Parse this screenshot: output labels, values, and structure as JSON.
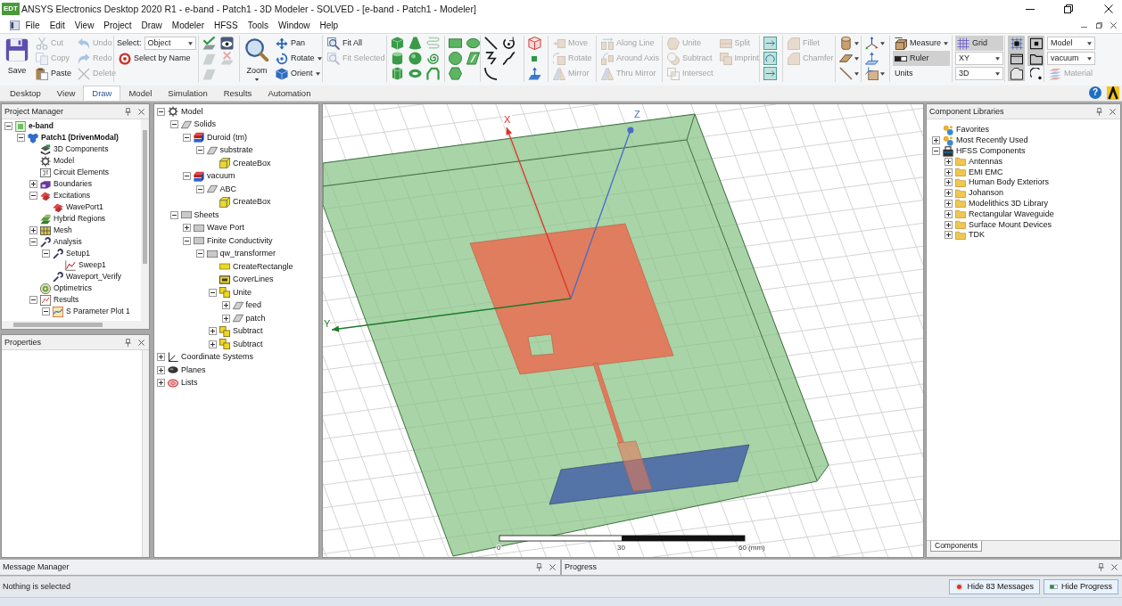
{
  "window": {
    "logo_text": "EDT",
    "title": "ANSYS Electronics Desktop 2020 R1 - e-band - Patch1 - 3D Modeler - SOLVED - [e-band - Patch1 - Modeler]"
  },
  "menu": [
    "File",
    "Edit",
    "View",
    "Project",
    "Draw",
    "Modeler",
    "HFSS",
    "Tools",
    "Window",
    "Help"
  ],
  "ribbon": {
    "groups": [
      {
        "columns": [
          [
            {
              "kind": "large",
              "label": "Save",
              "disabled": false
            }
          ],
          [
            {
              "kind": "button",
              "label": "Cut",
              "disabled": true
            },
            {
              "kind": "button",
              "label": "Copy",
              "disabled": true
            },
            {
              "kind": "button",
              "label": "Paste",
              "disabled": false
            }
          ],
          [
            {
              "kind": "button",
              "label": "Undo",
              "disabled": true
            },
            {
              "kind": "button",
              "label": "Redo",
              "disabled": true
            },
            {
              "kind": "button",
              "label": "Delete",
              "disabled": true
            }
          ]
        ]
      },
      {
        "columns": [
          [
            {
              "kind": "select",
              "label": "Select:",
              "value": "Object"
            },
            {
              "kind": "button",
              "label": "Select by Name",
              "disabled": false
            }
          ]
        ]
      },
      {
        "columns": [
          [
            {
              "kind": "icon",
              "disabled": false
            },
            {
              "kind": "icon",
              "disabled": true
            },
            {
              "kind": "icon",
              "disabled": true
            }
          ],
          [
            {
              "kind": "icon",
              "disabled": false
            },
            {
              "kind": "icon",
              "disabled": true
            }
          ]
        ]
      },
      {
        "columns": [
          [
            {
              "kind": "large-menu",
              "label": "Zoom",
              "disabled": false
            }
          ],
          [
            {
              "kind": "button",
              "label": "Pan",
              "disabled": false
            },
            {
              "kind": "menu-button",
              "label": "Rotate",
              "disabled": false
            },
            {
              "kind": "menu-button",
              "label": "Orient",
              "disabled": false
            }
          ]
        ]
      },
      {
        "columns": [
          [
            {
              "kind": "button",
              "label": "Fit All",
              "disabled": false
            },
            {
              "kind": "button",
              "label": "Fit Selected",
              "disabled": true
            }
          ]
        ]
      },
      {
        "columns": [
          [
            {
              "kind": "icon",
              "disabled": false
            },
            {
              "kind": "icon",
              "disabled": false
            },
            {
              "kind": "icon",
              "disabled": false
            }
          ],
          [
            {
              "kind": "icon",
              "disabled": false
            },
            {
              "kind": "icon",
              "disabled": false
            },
            {
              "kind": "icon",
              "disabled": false
            }
          ],
          [
            {
              "kind": "icon",
              "disabled": true
            },
            {
              "kind": "icon",
              "disabled": false
            },
            {
              "kind": "icon",
              "disabled": false
            }
          ]
        ]
      },
      {
        "columns": [
          [
            {
              "kind": "icon",
              "disabled": false
            },
            {
              "kind": "icon",
              "disabled": false
            },
            {
              "kind": "icon",
              "disabled": false
            }
          ],
          [
            {
              "kind": "icon",
              "disabled": false
            },
            {
              "kind": "icon",
              "disabled": false
            }
          ]
        ]
      },
      {
        "columns": [
          [
            {
              "kind": "icon",
              "disabled": false
            },
            {
              "kind": "icon",
              "disabled": false
            },
            {
              "kind": "icon",
              "disabled": false
            }
          ],
          [
            {
              "kind": "icon",
              "disabled": false
            },
            {
              "kind": "icon",
              "disabled": false
            }
          ]
        ]
      },
      {
        "columns": [
          [
            {
              "kind": "icon",
              "disabled": false
            },
            {
              "kind": "icon",
              "disabled": false
            },
            {
              "kind": "icon",
              "disabled": false
            }
          ]
        ]
      },
      {
        "columns": [
          [
            {
              "kind": "button",
              "label": "Move",
              "disabled": true
            },
            {
              "kind": "button",
              "label": "Rotate",
              "disabled": true
            },
            {
              "kind": "button",
              "label": "Mirror",
              "disabled": true
            }
          ]
        ]
      },
      {
        "columns": [
          [
            {
              "kind": "button",
              "label": "Along Line",
              "disabled": true
            },
            {
              "kind": "button",
              "label": "Around Axis",
              "disabled": true
            },
            {
              "kind": "button",
              "label": "Thru Mirror",
              "disabled": true
            }
          ]
        ]
      },
      {
        "columns": [
          [
            {
              "kind": "button",
              "label": "Unite",
              "disabled": true
            },
            {
              "kind": "button",
              "label": "Subtract",
              "disabled": true
            },
            {
              "kind": "button",
              "label": "Intersect",
              "disabled": true
            }
          ],
          [
            {
              "kind": "button",
              "label": "Split",
              "disabled": true
            },
            {
              "kind": "button",
              "label": "Imprint",
              "disabled": true
            }
          ]
        ]
      },
      {
        "columns": [
          [
            {
              "kind": "icon",
              "disabled": false
            },
            {
              "kind": "icon",
              "disabled": false
            },
            {
              "kind": "icon",
              "disabled": false
            }
          ]
        ]
      },
      {
        "columns": [
          [
            {
              "kind": "button",
              "label": "Fillet",
              "disabled": true
            },
            {
              "kind": "button",
              "label": "Chamfer",
              "disabled": true
            }
          ]
        ]
      },
      {
        "columns": [
          [
            {
              "kind": "icon-menu",
              "disabled": false
            },
            {
              "kind": "icon-menu",
              "disabled": false
            },
            {
              "kind": "icon-menu",
              "disabled": false
            }
          ]
        ]
      },
      {
        "columns": [
          [
            {
              "kind": "icon-menu",
              "disabled": false
            },
            {
              "kind": "icon",
              "disabled": false
            },
            {
              "kind": "icon-menu",
              "disabled": false
            }
          ]
        ]
      },
      {
        "columns": [
          [
            {
              "kind": "menu-button",
              "label": "Measure",
              "disabled": false
            },
            {
              "kind": "toggle",
              "label": "Ruler",
              "on": true
            },
            {
              "kind": "button",
              "label": "Units",
              "disabled": false
            }
          ]
        ]
      },
      {
        "columns": [
          [
            {
              "kind": "toggle",
              "label": "Grid",
              "on": true
            },
            {
              "kind": "select",
              "value": "XY"
            },
            {
              "kind": "select",
              "value": "3D"
            }
          ]
        ]
      },
      {
        "columns": [
          [
            {
              "kind": "icon-toggle",
              "on": true
            },
            {
              "kind": "icon-toggle",
              "on": true
            },
            {
              "kind": "icon-toggle",
              "on": true
            }
          ],
          [
            {
              "kind": "icon-toggle",
              "on": true
            },
            {
              "kind": "icon-toggle",
              "on": true
            },
            {
              "kind": "icon-toggle",
              "on": false
            }
          ]
        ]
      },
      {
        "columns": [
          [
            {
              "kind": "select",
              "value": "Model"
            },
            {
              "kind": "select",
              "value": "vacuum"
            },
            {
              "kind": "button",
              "label": "Material",
              "disabled": true
            }
          ]
        ]
      }
    ]
  },
  "ribbon_tabs": [
    {
      "label": "Desktop",
      "selected": false
    },
    {
      "label": "View",
      "selected": false
    },
    {
      "label": "Draw",
      "selected": true
    },
    {
      "label": "Model",
      "selected": false
    },
    {
      "label": "Simulation",
      "selected": false
    },
    {
      "label": "Results",
      "selected": false
    },
    {
      "label": "Automation",
      "selected": false
    }
  ],
  "help": "?",
  "project_manager": {
    "title": "Project Manager",
    "tree": [
      {
        "label": "e-band",
        "kind": "project",
        "expanded": true,
        "children": [
          {
            "label": "Patch1 (DrivenModal)",
            "kind": "design",
            "expanded": true,
            "children": [
              {
                "label": "3D Components",
                "kind": "components"
              },
              {
                "label": "Model",
                "kind": "model"
              },
              {
                "label": "Circuit Elements",
                "kind": "circuit"
              },
              {
                "label": "Boundaries",
                "kind": "boundaries",
                "expanded": false
              },
              {
                "label": "Excitations",
                "kind": "excitations",
                "expanded": true,
                "children": [
                  {
                    "label": "WavePort1",
                    "kind": "port"
                  }
                ]
              },
              {
                "label": "Hybrid Regions",
                "kind": "hybrid"
              },
              {
                "label": "Mesh",
                "kind": "mesh",
                "expanded": false
              },
              {
                "label": "Analysis",
                "kind": "analysis",
                "expanded": true,
                "children": [
                  {
                    "label": "Setup1",
                    "kind": "setup",
                    "expanded": true,
                    "children": [
                      {
                        "label": "Sweep1",
                        "kind": "sweep"
                      }
                    ]
                  },
                  {
                    "label": "Waveport_Verify",
                    "kind": "setup"
                  }
                ]
              },
              {
                "label": "Optimetrics",
                "kind": "optimetrics"
              },
              {
                "label": "Results",
                "kind": "results",
                "expanded": true,
                "children": [
                  {
                    "label": "S Parameter Plot 1",
                    "kind": "plot",
                    "expanded": true
                  }
                ]
              }
            ]
          }
        ]
      }
    ]
  },
  "properties": {
    "title": "Properties"
  },
  "model_tree": [
    {
      "label": "Model",
      "kind": "model",
      "expanded": true,
      "children": [
        {
          "label": "Solids",
          "kind": "solids",
          "expanded": true,
          "children": [
            {
              "label": "Duroid (tm)",
              "kind": "material",
              "expanded": true,
              "children": [
                {
                  "label": "substrate",
                  "kind": "object",
                  "expanded": true,
                  "children": [
                    {
                      "label": "CreateBox",
                      "kind": "command"
                    }
                  ]
                }
              ]
            },
            {
              "label": "vacuum",
              "kind": "material",
              "expanded": true,
              "children": [
                {
                  "label": "ABC",
                  "kind": "object",
                  "expanded": true,
                  "children": [
                    {
                      "label": "CreateBox",
                      "kind": "command"
                    }
                  ]
                }
              ]
            }
          ]
        },
        {
          "label": "Sheets",
          "kind": "sheets",
          "expanded": true,
          "children": [
            {
              "label": "Wave Port",
              "kind": "sheets",
              "expanded": false
            },
            {
              "label": "Finite Conductivity",
              "kind": "sheets",
              "expanded": true,
              "children": [
                {
                  "label": "qw_transformer",
                  "kind": "sheet",
                  "expanded": true,
                  "children": [
                    {
                      "label": "CreateRectangle",
                      "kind": "rectangle"
                    },
                    {
                      "label": "CoverLines",
                      "kind": "cover"
                    },
                    {
                      "label": "Unite",
                      "kind": "boolean",
                      "expanded": true,
                      "children": [
                        {
                          "label": "feed",
                          "kind": "object",
                          "expanded": false
                        },
                        {
                          "label": "patch",
                          "kind": "object",
                          "expanded": false
                        }
                      ]
                    },
                    {
                      "label": "Subtract",
                      "kind": "boolean",
                      "expanded": false
                    },
                    {
                      "label": "Subtract",
                      "kind": "boolean",
                      "expanded": false
                    }
                  ]
                }
              ]
            }
          ]
        }
      ]
    },
    {
      "label": "Coordinate Systems",
      "kind": "coordinates",
      "expanded": false
    },
    {
      "label": "Planes",
      "kind": "planes",
      "expanded": false
    },
    {
      "label": "Lists",
      "kind": "lists",
      "expanded": false
    }
  ],
  "modeler_view": {
    "axes": [
      {
        "label": "X"
      },
      {
        "label": "Y"
      },
      {
        "label": "Z"
      }
    ],
    "scale": [
      "0",
      "30",
      "60 (mm)"
    ]
  },
  "component_libraries": {
    "title": "Component Libraries",
    "tree": [
      {
        "label": "Favorites",
        "kind": "favorites"
      },
      {
        "label": "Most Recently Used",
        "kind": "favorites",
        "expanded": false
      },
      {
        "label": "HFSS Components",
        "kind": "library",
        "expanded": true,
        "children": [
          {
            "label": "Antennas",
            "kind": "folder",
            "expanded": false
          },
          {
            "label": "EMI EMC",
            "kind": "folder",
            "expanded": false
          },
          {
            "label": "Human Body Exteriors",
            "kind": "folder",
            "expanded": false
          },
          {
            "label": "Johanson",
            "kind": "folder",
            "expanded": false
          },
          {
            "label": "Modelithics 3D Library",
            "kind": "folder",
            "expanded": false
          },
          {
            "label": "Rectangular Waveguide",
            "kind": "folder",
            "expanded": false
          },
          {
            "label": "Surface Mount Devices",
            "kind": "folder",
            "expanded": false
          },
          {
            "label": "TDK",
            "kind": "folder",
            "expanded": false
          }
        ]
      }
    ],
    "tabs": [
      {
        "label": "Components",
        "selected": true
      }
    ]
  },
  "message_manager": {
    "title": "Message Manager"
  },
  "progress": {
    "title": "Progress"
  },
  "status_bar": {
    "text": "Nothing is selected",
    "buttons": [
      "Hide 83 Messages",
      "Hide Progress"
    ]
  }
}
